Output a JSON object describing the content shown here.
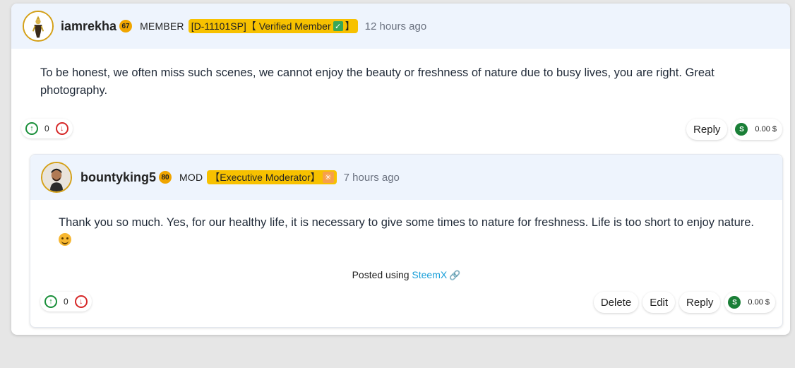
{
  "comment": {
    "username": "iamrekha",
    "reputation": "67",
    "role": "MEMBER",
    "tag_text": "[D-11101SP]【 Verified Member",
    "tag_end": "】",
    "time": "12 hours ago",
    "body": "To be honest, we often miss such scenes, we cannot enjoy the beauty or freshness of nature due to busy lives, you are right. Great photography.",
    "vote_count": "0",
    "reply_label": "Reply",
    "payout": "0.00 $"
  },
  "reply": {
    "username": "bountyking5",
    "reputation": "80",
    "role": "MOD",
    "tag_text": "【Executive Moderator】",
    "time": "7 hours ago",
    "body": "Thank you so much. Yes, for our healthy life, it is necessary to give some times to nature for freshness. Life is too short to enjoy nature.",
    "posted_prefix": "Posted using",
    "posted_link": "SteemX",
    "vote_count": "0",
    "delete_label": "Delete",
    "edit_label": "Edit",
    "reply_label": "Reply",
    "payout": "0.00 $"
  },
  "colors": {
    "header_bg": "#eef4fd",
    "tag_bg": "#f7c100",
    "upvote": "#1a8f3a",
    "downvote": "#d62828",
    "link": "#1a9fd9"
  }
}
